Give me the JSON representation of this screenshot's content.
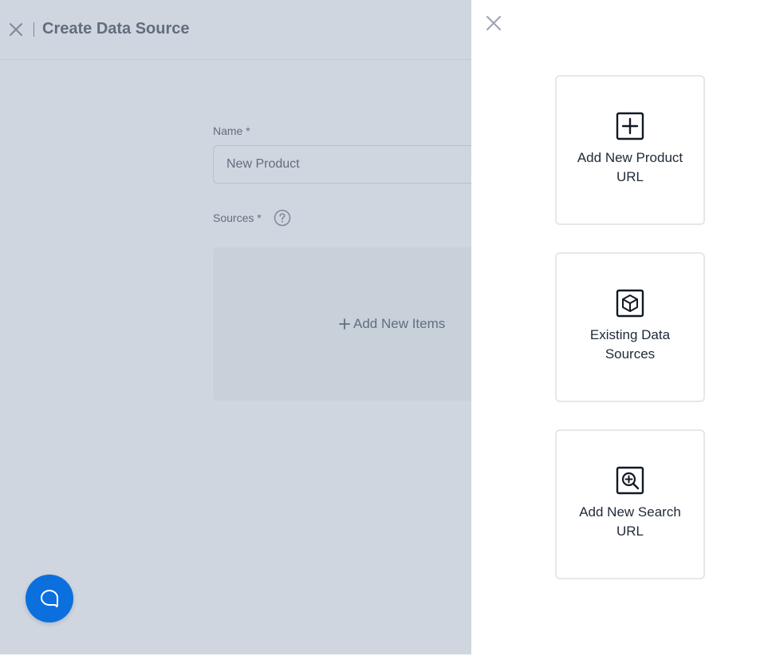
{
  "header": {
    "title": "Create Data Source"
  },
  "form": {
    "name_label": "Name *",
    "name_value": "New Product",
    "sources_label": "Sources *",
    "add_items_label": "Add New Items"
  },
  "drawer": {
    "options": [
      {
        "label": "Add New Product URL",
        "icon": "plus-square-icon"
      },
      {
        "label": "Existing Data Sources",
        "icon": "cube-icon"
      },
      {
        "label": "Add New Search URL",
        "icon": "zoom-in-icon"
      }
    ]
  },
  "colors": {
    "accent": "#0b6fde",
    "overlay": "#cbd5e1",
    "text": "#1f2937"
  }
}
